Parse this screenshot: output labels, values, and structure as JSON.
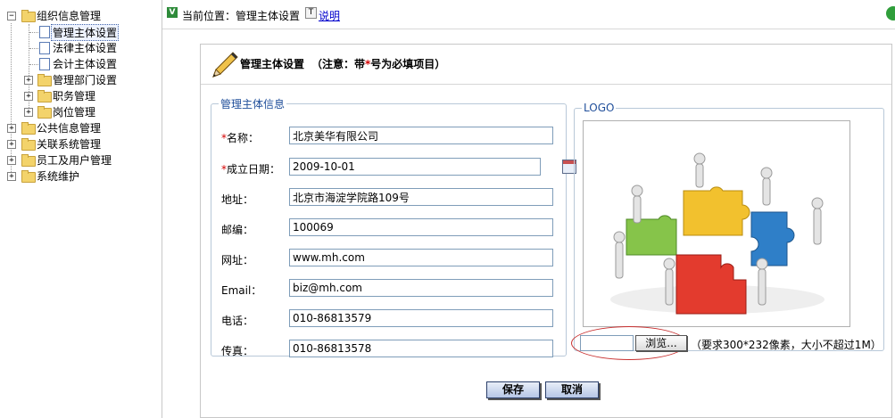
{
  "tree": {
    "root": {
      "label": "组织信息管理",
      "expander": "−"
    },
    "children": [
      {
        "label": "管理主体设置",
        "selected": true,
        "type": "page"
      },
      {
        "label": "法律主体设置",
        "type": "page"
      },
      {
        "label": "会计主体设置",
        "type": "page"
      },
      {
        "label": "管理部门设置",
        "expander": "+",
        "type": "folder"
      },
      {
        "label": "职务管理",
        "expander": "+",
        "type": "folder"
      },
      {
        "label": "岗位管理",
        "expander": "+",
        "type": "folder"
      }
    ],
    "others": [
      {
        "label": "公共信息管理",
        "expander": "+"
      },
      {
        "label": "关联系统管理",
        "expander": "+"
      },
      {
        "label": "员工及用户管理",
        "expander": "+"
      },
      {
        "label": "系统维护",
        "expander": "+"
      }
    ]
  },
  "header": {
    "location": "当前位置：管理主体设置",
    "help": "说明"
  },
  "form": {
    "title": "管理主体设置",
    "note_prefix": "（注意：带",
    "note_star": "*",
    "note_suffix": "号为必填项目）",
    "group_legend": "管理主体信息",
    "fields": {
      "name": {
        "label": "名称：",
        "value": "北京美华有限公司",
        "required": true
      },
      "date": {
        "label": "成立日期：",
        "value": "2009-10-01",
        "required": true
      },
      "address": {
        "label": "地址：",
        "value": "北京市海淀学院路109号"
      },
      "zip": {
        "label": "邮编：",
        "value": "100069"
      },
      "website": {
        "label": "网址：",
        "value": "www.mh.com"
      },
      "email": {
        "label": "Email：",
        "value": "biz@mh.com"
      },
      "phone": {
        "label": "电话：",
        "value": "010-86813579"
      },
      "fax": {
        "label": "传真：",
        "value": "010-86813578"
      }
    },
    "required_mark": "*",
    "logo": {
      "legend": "LOGO",
      "browse": "浏览...",
      "hint": "（要求300*232像素，大小不超过1M）",
      "file_value": ""
    },
    "buttons": {
      "save": "保存",
      "cancel": "取消"
    }
  }
}
